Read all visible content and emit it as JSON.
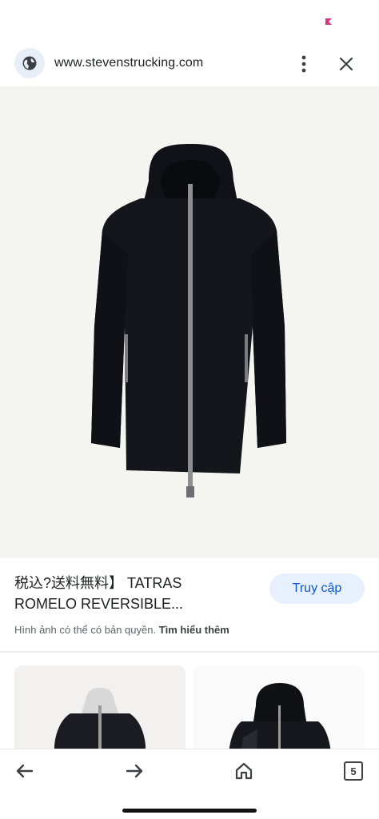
{
  "browser": {
    "url": "www.stevenstrucking.com",
    "site_icon": "globe-icon",
    "menu_icon": "more-vert-icon",
    "close_icon": "close-icon"
  },
  "image": {
    "subject": "black hooded parka jacket"
  },
  "caption": {
    "title_line1": "税込?送料無料】 TATRAS",
    "title_line2": "ROMELO REVERSIBLE...",
    "visit_label": "Truy cập",
    "copyright_text": "Hình ảnh có thể có bản quyền.",
    "learn_more": "Tìm hiểu thêm"
  },
  "nav": {
    "back_icon": "arrow-left-icon",
    "forward_icon": "arrow-right-icon",
    "home_icon": "home-icon",
    "tab_count": "5"
  },
  "colors": {
    "accent": "#0b57d0",
    "button_bg": "#e8f0fe",
    "status_dot": "#d63384"
  }
}
